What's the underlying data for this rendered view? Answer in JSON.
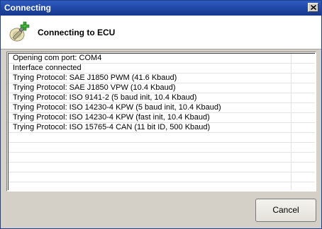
{
  "window": {
    "title": "Connecting",
    "close_icon": "close-icon"
  },
  "header": {
    "icon": "connect-plus-icon",
    "title": "Connecting to ECU"
  },
  "log": {
    "lines": [
      "Opening com port: COM4",
      "Interface connected",
      "Trying Protocol: SAE J1850 PWM (41.6 Kbaud)",
      "Trying Protocol: SAE J1850 VPW (10.4 Kbaud)",
      "Trying Protocol: ISO 9141-2 (5 baud init, 10.4 Kbaud)",
      "Trying Protocol: ISO 14230-4 KPW (5 baud init, 10.4 Kbaud)",
      "Trying Protocol: ISO 14230-4 KPW (fast init, 10.4 Kbaud)",
      "Trying Protocol: ISO 15765-4 CAN (11 bit ID, 500 Kbaud)"
    ]
  },
  "buttons": {
    "cancel_label": "Cancel"
  },
  "colors": {
    "titlebar": "#224aa8",
    "dialog_bg": "#d4d0c8",
    "header_bg": "#ffffff",
    "grid_line": "#e4e4e4"
  }
}
